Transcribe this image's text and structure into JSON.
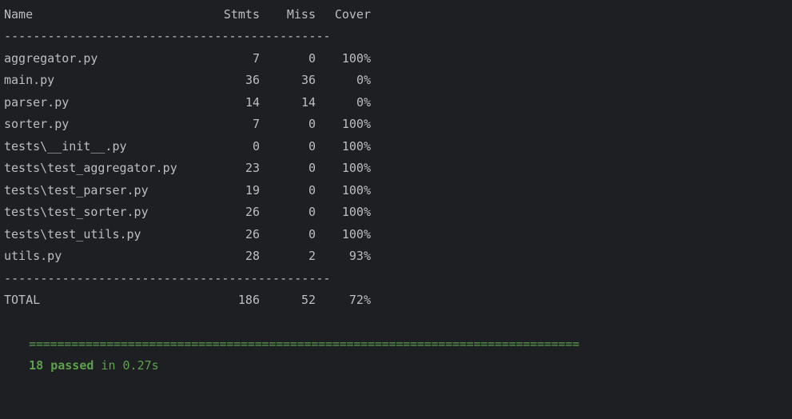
{
  "header": {
    "name": "Name",
    "stmts": "Stmts",
    "miss": "Miss",
    "cover": "Cover"
  },
  "separator": "---------------------------------------------",
  "rows": [
    {
      "name": "aggregator.py",
      "stmts": "7",
      "miss": "0",
      "cover": "100%"
    },
    {
      "name": "main.py",
      "stmts": "36",
      "miss": "36",
      "cover": "0%"
    },
    {
      "name": "parser.py",
      "stmts": "14",
      "miss": "14",
      "cover": "0%"
    },
    {
      "name": "sorter.py",
      "stmts": "7",
      "miss": "0",
      "cover": "100%"
    },
    {
      "name": "tests\\__init__.py",
      "stmts": "0",
      "miss": "0",
      "cover": "100%"
    },
    {
      "name": "tests\\test_aggregator.py",
      "stmts": "23",
      "miss": "0",
      "cover": "100%"
    },
    {
      "name": "tests\\test_parser.py",
      "stmts": "19",
      "miss": "0",
      "cover": "100%"
    },
    {
      "name": "tests\\test_sorter.py",
      "stmts": "26",
      "miss": "0",
      "cover": "100%"
    },
    {
      "name": "tests\\test_utils.py",
      "stmts": "26",
      "miss": "0",
      "cover": "100%"
    },
    {
      "name": "utils.py",
      "stmts": "28",
      "miss": "2",
      "cover": "93%"
    }
  ],
  "total": {
    "name": "TOTAL",
    "stmts": "186",
    "miss": "52",
    "cover": "72%"
  },
  "summary": {
    "bar": "==============================================================================",
    "passed": "18 passed",
    "rest": " in 0.27s"
  },
  "colors": {
    "background": "#1e1f22",
    "text": "#bcbec4",
    "success": "#5fa04e"
  }
}
